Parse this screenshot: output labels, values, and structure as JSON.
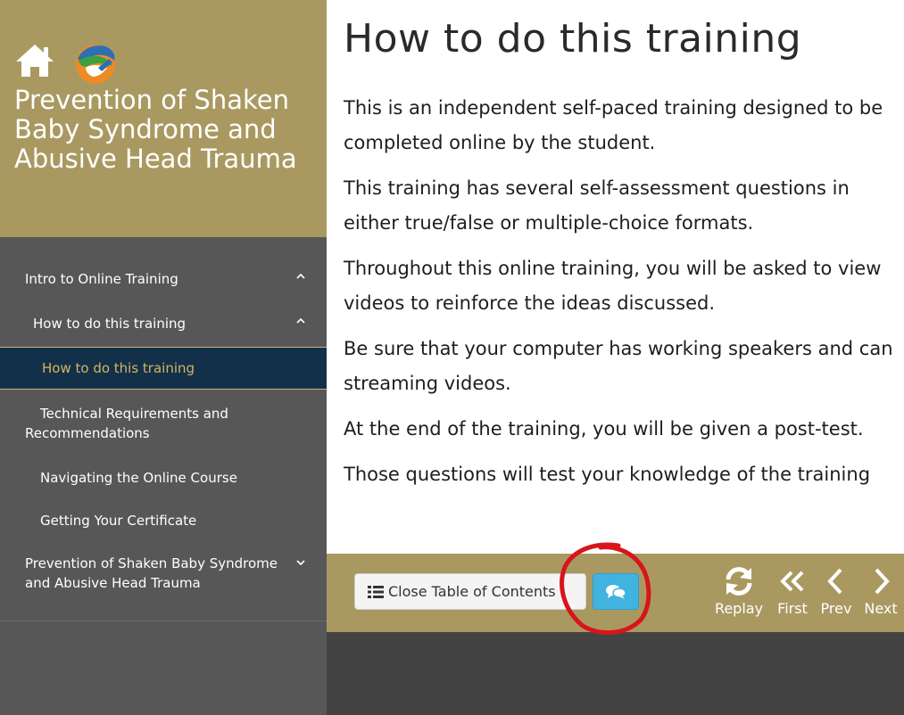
{
  "sidebar": {
    "course_title": "Prevention of Shaken Baby Syndrome and Abusive Head Trauma",
    "toc": [
      {
        "label": "Intro to Online Training",
        "indent": 0,
        "state": "expanded"
      },
      {
        "label": "How to do this training",
        "indent": 1,
        "state": "expanded"
      },
      {
        "label": "How to do this training",
        "indent": 2,
        "state": "active"
      },
      {
        "label": "Technical Requirements and Recommendations",
        "indent": 2,
        "state": "normal"
      },
      {
        "label": "Navigating the Online Course",
        "indent": 2,
        "state": "normal"
      },
      {
        "label": "Getting Your Certificate",
        "indent": 2,
        "state": "normal"
      },
      {
        "label": "Prevention of Shaken Baby Syndrome and Abusive Head Trauma",
        "indent": 0,
        "state": "collapsed"
      }
    ]
  },
  "main": {
    "title": "How to do this training",
    "paragraphs": [
      "This is an independent self-paced training designed to be",
      "completed online by the student.",
      "This training has several self-assessment questions in",
      "either true/false or multiple-choice formats.",
      "Throughout this online training, you will be asked to view",
      "videos to reinforce the ideas discussed.",
      "Be sure that your computer has working speakers and can",
      "streaming videos.",
      "At the end of the training, you will be given a post-test.",
      "Those questions will test your knowledge of the training"
    ]
  },
  "toolbar": {
    "close_toc_label": "Close Table of Contents",
    "replay_label": "Replay",
    "first_label": "First",
    "prev_label": "Prev",
    "next_label": "Next"
  },
  "icons": {
    "home": "home-icon",
    "logo": "globe-logo-icon",
    "chevron_up": "chevron-up-icon",
    "chevron_down": "chevron-down-icon",
    "list": "list-icon",
    "chat": "chat-bubbles-icon",
    "replay": "refresh-icon",
    "first": "double-chevron-left-icon",
    "prev": "chevron-left-icon",
    "next": "chevron-right-icon"
  },
  "colors": {
    "brand_gold": "#a99961",
    "sidebar_bg": "#575757",
    "active_item_bg": "#12304a",
    "active_item_text": "#d7b45f",
    "chat_button": "#41b3e0",
    "annotation_red": "#d9141b"
  }
}
